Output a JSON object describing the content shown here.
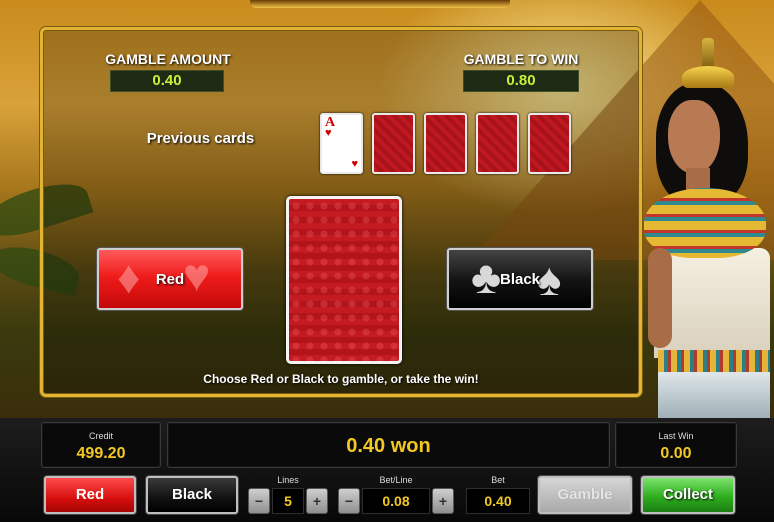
{
  "gamble": {
    "amount_label": "GAMBLE AMOUNT",
    "amount_value": "0.40",
    "towin_label": "GAMBLE TO WIN",
    "towin_value": "0.80",
    "previous_label": "Previous cards",
    "previous_first_card": {
      "rank": "A",
      "suit": "♥"
    },
    "red_label": "Red",
    "black_label": "Black",
    "instruction": "Choose Red or Black to gamble, or take the win!"
  },
  "status": {
    "credit_label": "Credit",
    "credit_value": "499.20",
    "message": "0.40 won",
    "lastwin_label": "Last Win",
    "lastwin_value": "0.00"
  },
  "controls": {
    "red_label": "Red",
    "black_label": "Black",
    "lines_label": "Lines",
    "lines_value": "5",
    "betline_label": "Bet/Line",
    "betline_value": "0.08",
    "bet_label": "Bet",
    "bet_value": "0.40",
    "minus_glyph": "−",
    "plus_glyph": "+",
    "gamble_label": "Gamble",
    "collect_label": "Collect"
  },
  "colors": {
    "panel_border": "#e2b433",
    "value_green": "#c6f03a",
    "value_yellow": "#f3c823",
    "red_button": "#f01c1c",
    "collect_green": "#2fae1e"
  }
}
